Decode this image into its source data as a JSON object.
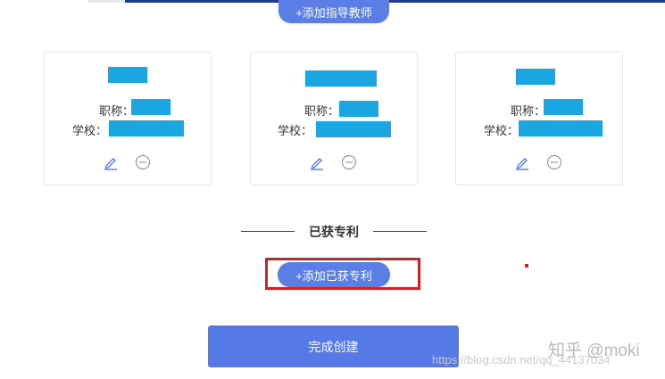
{
  "header": {
    "add_advisor_label": "+添加指导教师"
  },
  "advisors": [
    {
      "title_label": "职称：",
      "school_label": "学校："
    },
    {
      "title_label": "职称：",
      "school_label": "学校："
    },
    {
      "title_label": "职称：",
      "school_label": "学校："
    }
  ],
  "patents": {
    "section_title": "已获专利",
    "add_label": "+添加已获专利"
  },
  "footer": {
    "finish_label": "完成创建"
  },
  "watermarks": {
    "zhihu": "知乎 @moki",
    "csdn": "https://blog.csdn.net/qq_44137034"
  },
  "colors": {
    "accent": "#5b7ee6",
    "redaction": "#1aa6e0",
    "highlight": "#c8252b"
  }
}
